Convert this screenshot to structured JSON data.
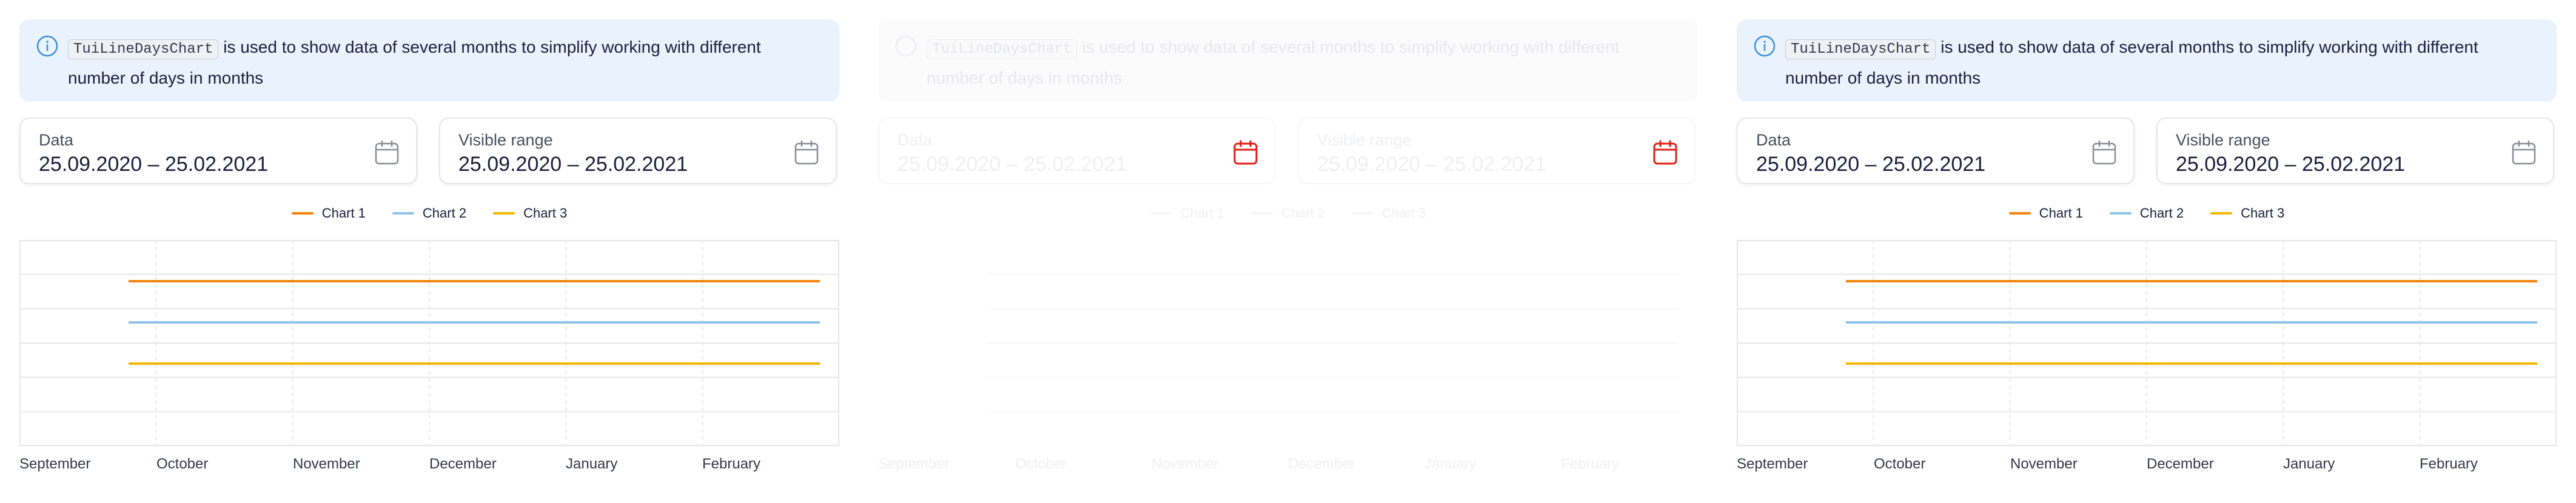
{
  "notice": {
    "code": "TuiLineDaysChart",
    "text": " is used to show data of several months to simplify working with different number of days in months"
  },
  "data_field": {
    "label": "Data",
    "value": "25.09.2020 – 25.02.2021"
  },
  "range_field": {
    "label": "Visible range",
    "value": "25.09.2020 – 25.02.2021"
  },
  "legend": [
    {
      "label": "Chart 1",
      "color": "#f5840c"
    },
    {
      "label": "Chart 2",
      "color": "#8ec4ea"
    },
    {
      "label": "Chart 3",
      "color": "#f2b705"
    }
  ],
  "x_labels": [
    "September",
    "October",
    "November",
    "December",
    "January",
    "February"
  ],
  "colors": {
    "accent_error": "#e01f19",
    "notice_bg": "#eaf3fd",
    "info_icon": "#3d8fd9"
  },
  "icons": {
    "info": "info-icon",
    "calendar": "calendar-icon"
  },
  "chart_data": {
    "type": "line",
    "x": [
      "September",
      "October",
      "November",
      "December",
      "January",
      "February"
    ],
    "series": [
      {
        "name": "Chart 1",
        "values": [
          3,
          3,
          3,
          3,
          3,
          3,
          3
        ]
      },
      {
        "name": "Chart 2",
        "values": [
          2,
          2,
          2,
          2,
          2,
          2,
          2
        ]
      },
      {
        "name": "Chart 3",
        "values": [
          1,
          1,
          1,
          1,
          1,
          1,
          1
        ]
      }
    ],
    "ylim": [
      -1,
      4
    ],
    "grid": true
  },
  "panels": {
    "left": {
      "state": "normal"
    },
    "middle": {
      "state": "faded"
    },
    "right": {
      "state": "normal"
    }
  }
}
